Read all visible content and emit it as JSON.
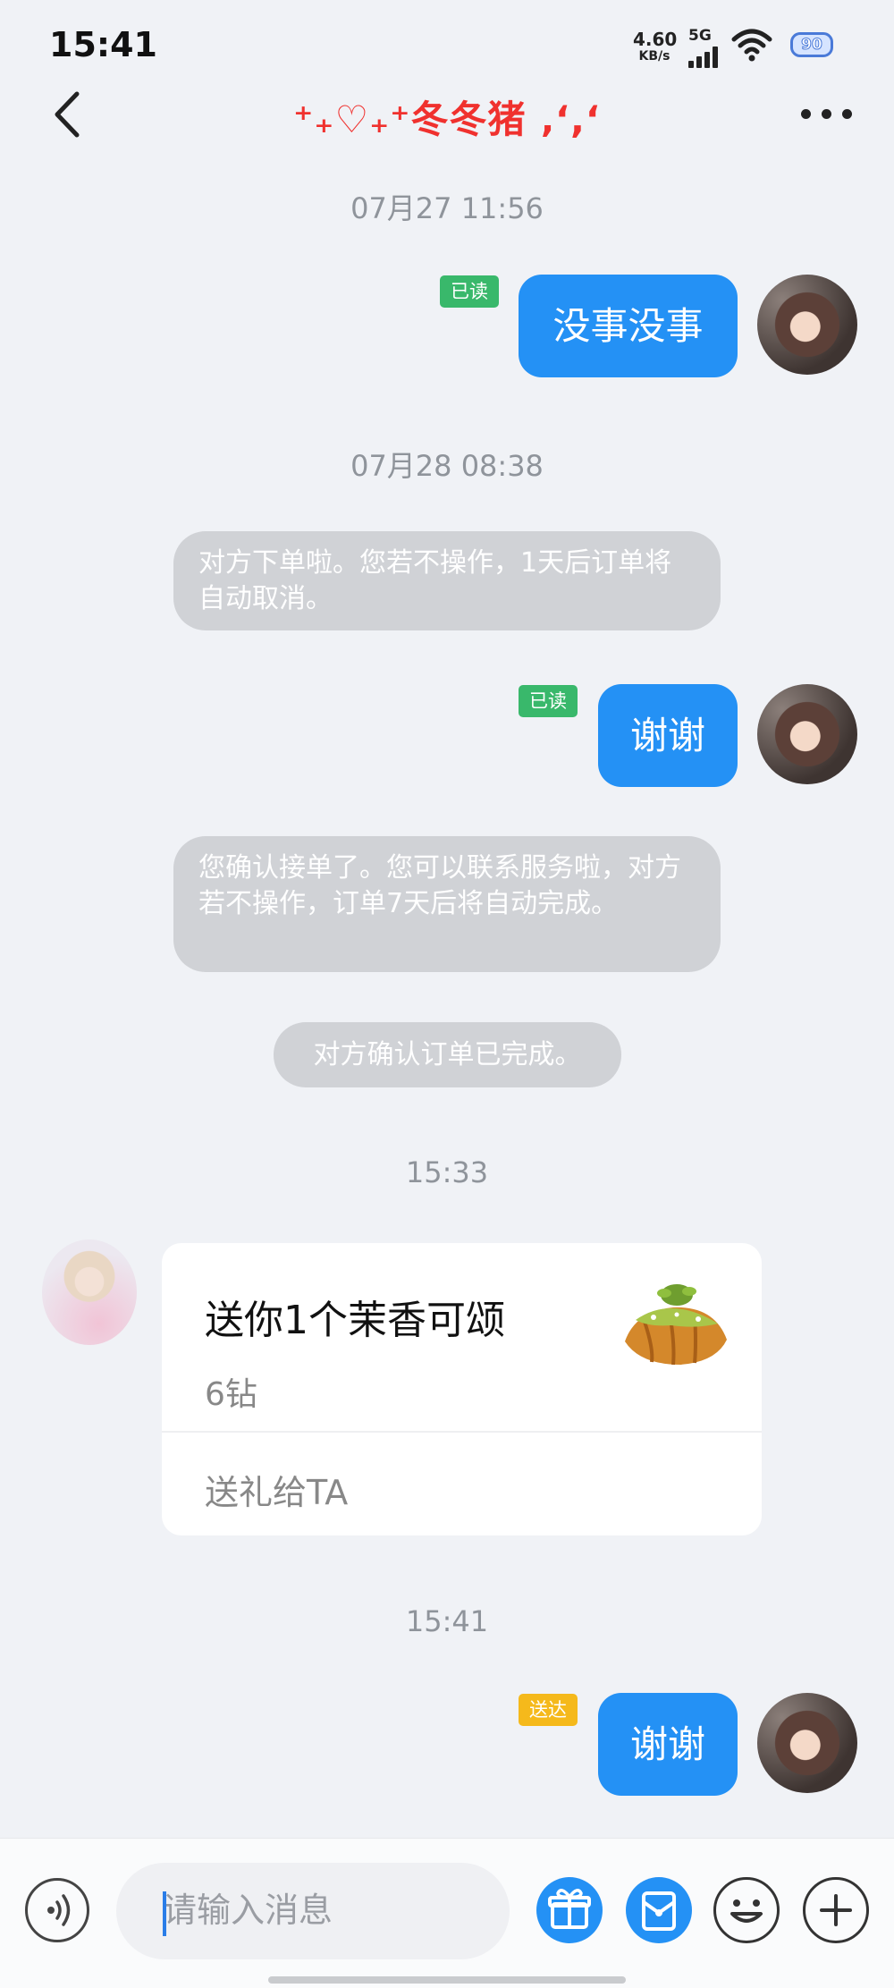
{
  "status_bar": {
    "time": "15:41",
    "net_speed": "4.60",
    "net_unit": "KB/s",
    "network": "5G",
    "battery": "90"
  },
  "nav": {
    "title": "⁺₊♡₊⁺冬冬猪 ‚‘,‘"
  },
  "messages": {
    "ts1": "07月27 11:56",
    "m1": {
      "text": "没事没事",
      "badge": "已读"
    },
    "ts2": "07月28 08:38",
    "sys1": "对方下单啦。您若不操作，1天后订单将自动取消。",
    "m2": {
      "text": "谢谢",
      "badge": "已读"
    },
    "sys2": "您确认接单了。您可以联系服务啦，对方若不操作，订单7天后将自动完成。",
    "sys3": "对方确认订单已完成。",
    "ts3": "15:33",
    "gift": {
      "title": "送你1个茉香可颂",
      "price": "6钻",
      "action": "送礼给TA"
    },
    "ts4": "15:41",
    "m3": {
      "text": "谢谢",
      "badge": "送达"
    }
  },
  "input": {
    "placeholder": "请输入消息"
  },
  "colors": {
    "accent": "#2491f5",
    "read_badge": "#39b86b",
    "sent_badge": "#f5b91b",
    "title": "#f0312e"
  }
}
